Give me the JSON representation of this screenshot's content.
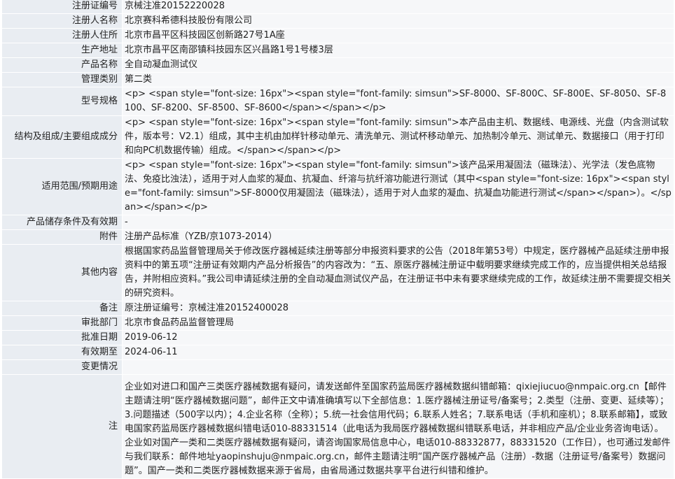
{
  "rows": [
    {
      "label": "注册证编号",
      "value": "京械注准20152220028"
    },
    {
      "label": "注册人名称",
      "value": "北京赛科希德科技股份有限公司"
    },
    {
      "label": "注册人住所",
      "value": "北京市昌平区科技园区创新路27号1A座"
    },
    {
      "label": "生产地址",
      "value": "北京市昌平区南邵镇科技园东区兴昌路1号1号楼3层"
    },
    {
      "label": "产品名称",
      "value": "全自动凝血测试仪"
    },
    {
      "label": "管理类别",
      "value": "第二类"
    },
    {
      "label": "型号规格",
      "value": "<p> <span style=\"font-size: 16px\"><span style=\"font-family: simsun\">SF-8000、SF-800C、SF-800E、SF-8050、SF-8100、SF-8200、SF-8500、SF-8600</span></span></p>"
    },
    {
      "label": "结构及组成/主要组成成分",
      "value": "<p> <span style=\"font-size: 16px\"><span style=\"font-family: simsun\">本产品由主机、数据线、电源线、光盘（内含测试软件，版本号：V2.1）组成，其中主机由加样针移动单元、清洗单元、测试杯移动单元、加热制冷单元、测试单元、数据接口（用于打印和向PC机数据传输）组成。</span></span></p>"
    },
    {
      "label": "适用范围/预期用途",
      "value": "<p> <span style=\"font-size: 16px\"><span style=\"font-family: simsun\">该产品采用凝固法（磁珠法）、光学法（发色底物法、免疫比浊法），适用于对人血浆的凝血、抗凝血、纤溶与抗纤溶功能进行测试（其中<span style=\"font-size: 16px\"><span style=\"font-family: simsun\">SF-8000仅用凝固法（磁珠法），适用于对人血浆的凝血、抗凝血功能进行测试</span></span>）。</span></span></p>"
    },
    {
      "label": "产品储存条件及有效期",
      "value": "-"
    },
    {
      "label": "附件",
      "value": "注册产品标准（YZB/京1073-2014）"
    },
    {
      "label": "其他内容",
      "value": "根据国家药品监督管理局关于修改医疗器械延续注册等部分申报资料要求的公告（2018年第53号）中规定，医疗器械产品延续注册申报资料中的第五项“注册证有效期内产品分析报告”的内容改为：“五、原医疗器械注册证中载明要求继续完成工作的，应当提供相关总结报告，并附相应资料。”我公司申请延续注册的全自动凝血测试仪产品，在注册证书中未有要求继续完成的工作，故延续注册不需要提交相关的研究资料。"
    },
    {
      "label": "备注",
      "value": "原注册证编号：京械注准20152400028"
    },
    {
      "label": "审批部门",
      "value": "北京市食品药品监督管理局"
    },
    {
      "label": "批准日期",
      "value": "2019-06-12"
    },
    {
      "label": "有效期至",
      "value": "2024-06-11"
    },
    {
      "label": "变更情况",
      "value": ""
    }
  ],
  "note": {
    "label": "注",
    "text": "企业如对进口和国产三类医疗器械数据有疑问，请发送邮件至国家药监局医疗器械数据纠错邮箱：qixiejiucuo@nmpaic.org.cn【邮件主题请注明“医疗器械数据问题”，邮件正文中请准确填写以下全部信息：1.医疗器械注册证号/备案号；2.类型（注册、变更、延续等）；3.问题描述（500字以内）；4.企业名称（全称）；5.统一社会信用代码；6.联系人姓名；7.联系电话（手机和座机）；8.联系邮箱】，或致电国家药监局医疗器械数据纠错电话010-88331514（此电话为我局医疗器械数据纠错联系电话，并非相应产品/企业业务咨询电话）。企业如对国产一类和二类医疗器械数据有疑问，请咨询国家局信息中心，电话010-88332877，88331520（工作日），也可通过发邮件与我们联系：邮件地址yaopinshuju@nmpaic.org.cn，邮件主题请注明“国产医疗器械产品（注册）-数据（注册证号/备案号）数据问题”。国产一类和二类医疗器械数据来源于省局，由省局通过数据共享平台进行纠错和维护。"
  }
}
